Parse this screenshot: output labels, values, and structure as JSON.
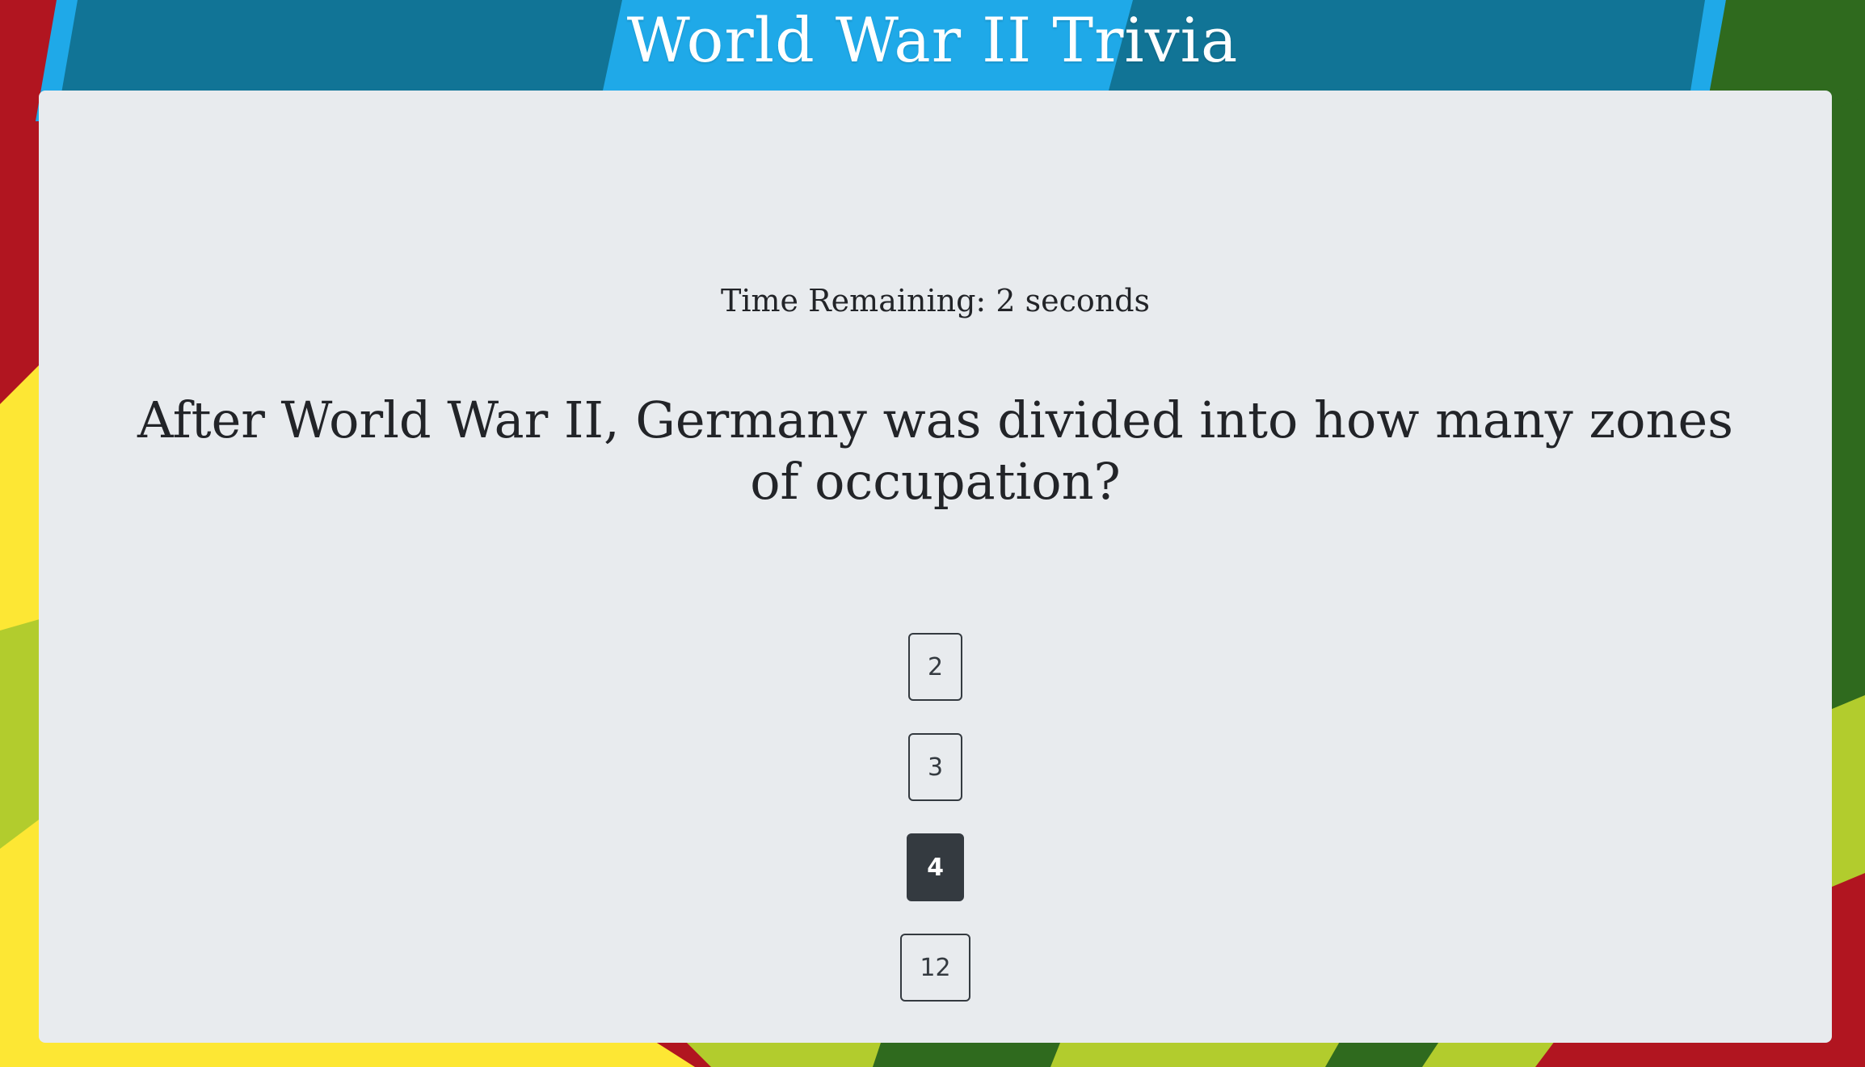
{
  "header": {
    "title": "World War II Trivia"
  },
  "game": {
    "timer_text": "Time Remaining: 2 seconds",
    "question": "After World War II, Germany was divided into how many zones of occupation?",
    "answers": [
      "2",
      "3",
      "4",
      "12"
    ],
    "selected_answer": "4"
  },
  "colors": {
    "header_blue": "#1fa9e8",
    "dark_teal": "#117496",
    "red": "#b11520",
    "yellow": "#fde734",
    "lime": "#b2cc2d",
    "dark_green": "#2f6a1e",
    "card_bg": "#e8ebee",
    "button_dark": "#343a40"
  }
}
